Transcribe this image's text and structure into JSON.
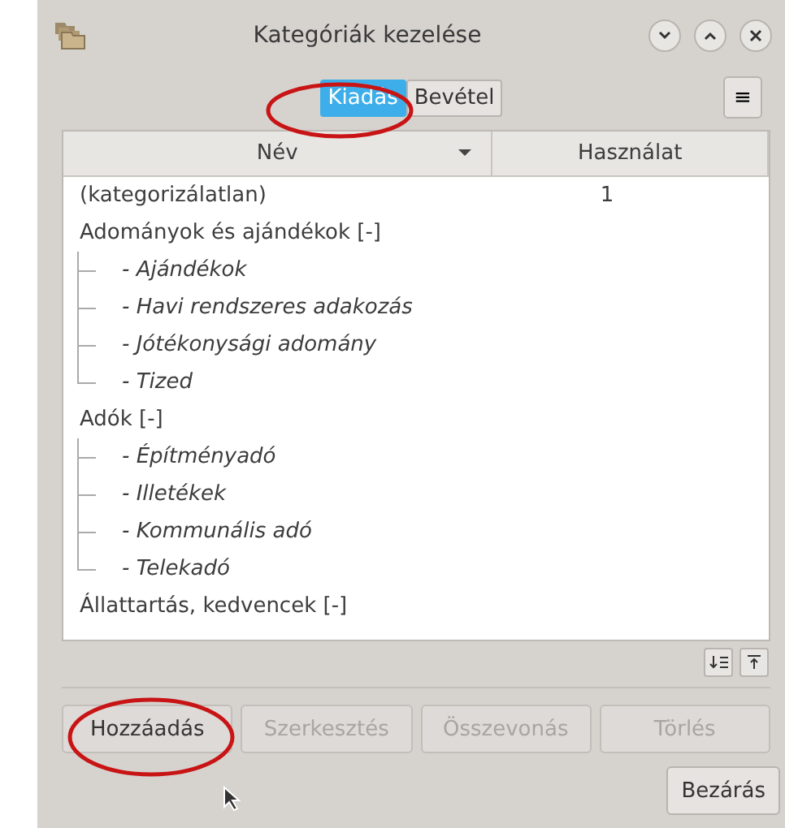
{
  "window": {
    "title": "Kategóriák kezelése"
  },
  "tabs": [
    {
      "label": "Kiadás",
      "selected": true,
      "circled": true
    },
    {
      "label": "Bevétel",
      "selected": false,
      "circled": false
    }
  ],
  "menu_button": {
    "label": "≡"
  },
  "table": {
    "columns": [
      {
        "label": "Név",
        "sorted": true
      },
      {
        "label": "Használat",
        "sorted": false
      }
    ],
    "rows": [
      {
        "name": "(kategorizálatlan)",
        "usage": "1",
        "children": []
      },
      {
        "name": "Adományok és ajándékok [-]",
        "children": [
          {
            "name": "- Ajándékok"
          },
          {
            "name": "- Havi rendszeres adakozás"
          },
          {
            "name": "- Jótékonysági adomány"
          },
          {
            "name": "- Tized"
          }
        ]
      },
      {
        "name": "Adók [-]",
        "children": [
          {
            "name": "- Építményadó"
          },
          {
            "name": "- Illetékek"
          },
          {
            "name": "- Kommunális adó"
          },
          {
            "name": "- Telekadó"
          }
        ]
      },
      {
        "name": "Állattartás, kedvencek [-]",
        "children": []
      }
    ]
  },
  "buttons": [
    {
      "label": "Hozzáadás",
      "disabled": false,
      "circled": true
    },
    {
      "label": "Szerkesztés",
      "disabled": true,
      "circled": false
    },
    {
      "label": "Összevonás",
      "disabled": true,
      "circled": false
    },
    {
      "label": "Törlés",
      "disabled": true,
      "circled": false
    }
  ],
  "close_button": {
    "label": "Bezárás"
  }
}
